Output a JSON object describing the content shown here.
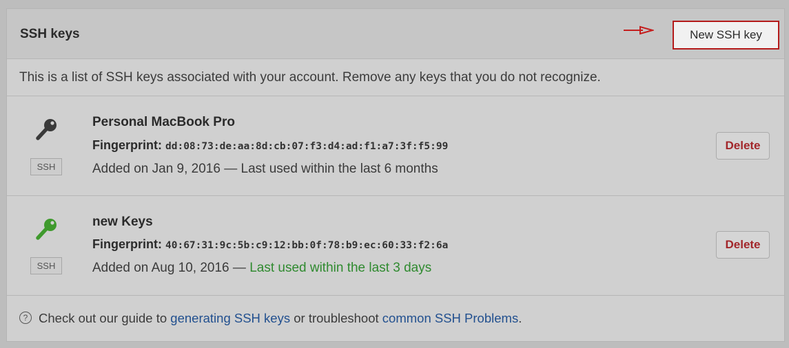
{
  "header": {
    "title": "SSH keys",
    "new_key_label": "New SSH key",
    "arrow_color": "#c41e1e"
  },
  "description": "This is a list of SSH keys associated with your account. Remove any keys that you do not recognize.",
  "keys": [
    {
      "title": "Personal MacBook Pro",
      "fingerprint_label": "Fingerprint:",
      "fingerprint": "dd:08:73:de:aa:8d:cb:07:f3:d4:ad:f1:a7:3f:f5:99",
      "added": "Added on Jan 9, 2016 — ",
      "last_used": "Last used within the last 6 months",
      "badge": "SSH",
      "delete_label": "Delete",
      "icon": "key-icon",
      "icon_color": "#3a3a3a",
      "recent": false
    },
    {
      "title": "new Keys",
      "fingerprint_label": "Fingerprint:",
      "fingerprint": "40:67:31:9c:5b:c9:12:bb:0f:78:b9:ec:60:33:f2:6a",
      "added": "Added on Aug 10, 2016 — ",
      "last_used": "Last used within the last 3 days",
      "badge": "SSH",
      "delete_label": "Delete",
      "icon": "key-icon",
      "icon_color": "#3f9a2d",
      "recent": true
    }
  ],
  "footer": {
    "help_icon": "?",
    "text_before": "Check out our guide to ",
    "link1": "generating SSH keys",
    "text_middle": " or troubleshoot ",
    "link2": "common SSH Problems",
    "text_after": "."
  }
}
